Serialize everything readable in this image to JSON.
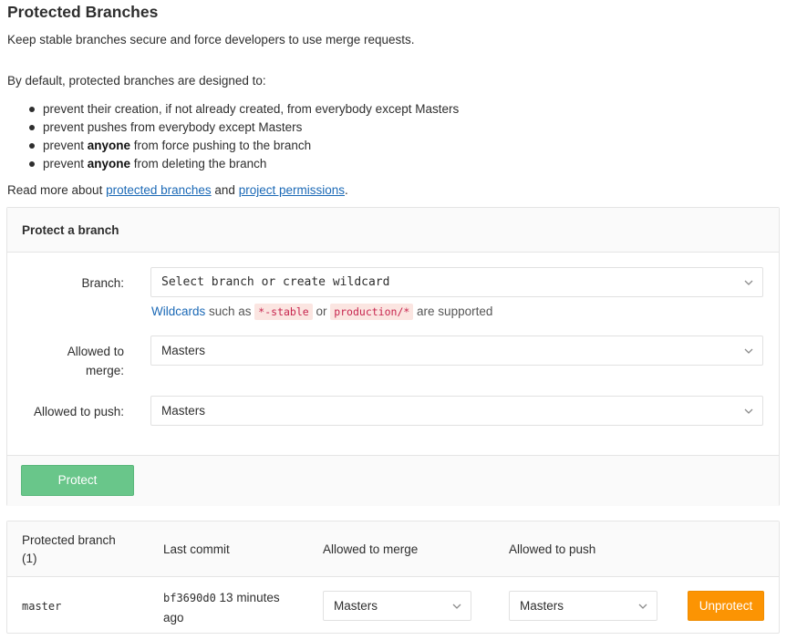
{
  "header": {
    "title": "Protected Branches",
    "subtitle": "Keep stable branches secure and force developers to use merge requests."
  },
  "intro": "By default, protected branches are designed to:",
  "rules": [
    {
      "before": "prevent their creation, if not already created, from everybody except Masters",
      "bold": "",
      "after": ""
    },
    {
      "before": "prevent pushes from everybody except Masters",
      "bold": "",
      "after": ""
    },
    {
      "before": "prevent ",
      "bold": "anyone",
      "after": " from force pushing to the branch"
    },
    {
      "before": "prevent ",
      "bold": "anyone",
      "after": " from deleting the branch"
    }
  ],
  "read_more": {
    "prefix": "Read more about ",
    "link1": "protected branches",
    "middle": " and ",
    "link2": "project permissions",
    "suffix": "."
  },
  "protect_form": {
    "title": "Protect a branch",
    "branch_label": "Branch:",
    "branch_placeholder": "Select branch or create wildcard",
    "hint_link": "Wildcards",
    "hint_text1": " such as ",
    "hint_code1": "*-stable",
    "hint_text2": " or ",
    "hint_code2": "production/*",
    "hint_text3": " are supported",
    "merge_label_line1": "Allowed to",
    "merge_label_line2": "merge:",
    "merge_value": "Masters",
    "push_label": "Allowed to push:",
    "push_value": "Masters",
    "protect_button": "Protect"
  },
  "table": {
    "headers": {
      "branch_line1": "Protected branch",
      "branch_line2": "(1)",
      "last_commit": "Last commit",
      "allowed_merge": "Allowed to merge",
      "allowed_push": "Allowed to push"
    },
    "rows": [
      {
        "branch": "master",
        "commit_sha": "bf3690d0",
        "commit_time_line1": " 13 minutes",
        "commit_time_line2": "ago",
        "merge": "Masters",
        "push": "Masters",
        "action": "Unprotect"
      }
    ]
  },
  "colors": {
    "protect_button": "#69c68a",
    "unprotect_button": "#fc9403",
    "link": "#1b69b6",
    "code_text": "#c7254e"
  }
}
